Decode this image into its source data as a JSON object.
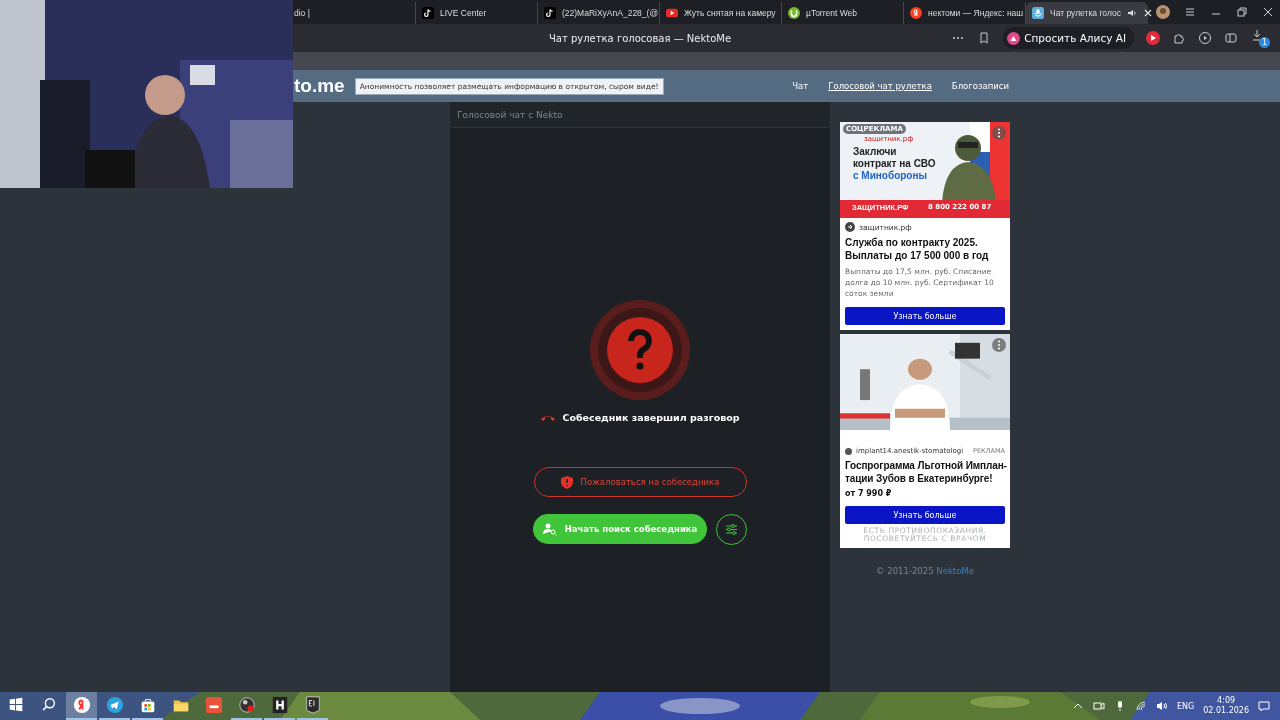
{
  "browser": {
    "tabs": [
      {
        "label": "dio |",
        "kind": "none",
        "selected": false
      },
      {
        "label": "LIVE Center",
        "kind": "tiktok",
        "selected": false
      },
      {
        "label": "(22)MaRiXyAnA_228_(@",
        "kind": "tiktok",
        "selected": false
      },
      {
        "label": "Жуть снятая на камеру",
        "kind": "youtube",
        "selected": false
      },
      {
        "label": "µTorrent Web",
        "kind": "torrent",
        "selected": false
      },
      {
        "label": "нектоми — Яндекс: наш",
        "kind": "yandex",
        "selected": false
      },
      {
        "label": "Чат рулетка голос",
        "kind": "site",
        "selected": true
      }
    ],
    "page_title": "Чат рулетка голосовая — NektoMe",
    "alice_button": "Спросить Алису AI",
    "downloads_badge": "1"
  },
  "site": {
    "logo": "to.me",
    "notice": "Анонимность позволяет размещать информацию в открытом, сыром виде!",
    "nav": [
      {
        "label": "Чат",
        "selected": false
      },
      {
        "label": "Голосовой чат рулетка",
        "selected": true
      },
      {
        "label": "Блогозаписи",
        "selected": false
      }
    ]
  },
  "chat": {
    "title": "Голосовой чат с Nekto",
    "status": "Собеседник завершил разговор",
    "report_button": "Пожаловаться на собеседника",
    "search_button": "Начать поиск собеседника"
  },
  "ad_top": {
    "badge": "СОЦРЕКЛАМА",
    "banner_logo": "защитник.рф",
    "banner_lines": [
      "Заключи",
      "контракт на СВО",
      "с Минобороны"
    ],
    "brand": "ЗАЩИТНИК.РФ",
    "phone": "8 800 222 00 87",
    "domain": "защитник.рф",
    "title": "Служба по контракту 2025. Выплаты до 17 500 000 в год",
    "text": "Выплаты до 17,5 млн. руб. Списание долга до 10 млн. руб. Сертификат 10 соток земли",
    "button": "Узнать больше"
  },
  "ad_bottom": {
    "domain": "implant14.anestik-stomatologi",
    "label": "РЕКЛАМА",
    "title_lines": [
      "Госпрограмма Льготной Имплан-",
      "тации Зубов в Екатеринбурге!"
    ],
    "price": "от 7 990 ₽",
    "button": "Узнать больше",
    "disclaimer_lines": [
      "ЕСТЬ ПРОТИВОПОКАЗАНИЯ.",
      "ПОСОВЕТУЙТЕСЬ С ВРАЧОМ"
    ]
  },
  "footer": {
    "copyright": "© 2011-2025",
    "link": "NektoMe"
  },
  "taskbar": {
    "apps": [
      {
        "kind": "yandex",
        "selected": true,
        "running": true
      },
      {
        "kind": "telegram",
        "selected": false,
        "running": true
      },
      {
        "kind": "store",
        "selected": false,
        "running": true
      },
      {
        "kind": "explorer",
        "selected": false,
        "running": false
      },
      {
        "kind": "dts",
        "selected": false,
        "running": false
      },
      {
        "kind": "obs",
        "selected": false,
        "running": true
      },
      {
        "kind": "h",
        "selected": false,
        "running": true
      },
      {
        "kind": "epic",
        "selected": false,
        "running": true
      }
    ],
    "language": "ENG",
    "time": "4:09",
    "date": "02.01.2026"
  }
}
